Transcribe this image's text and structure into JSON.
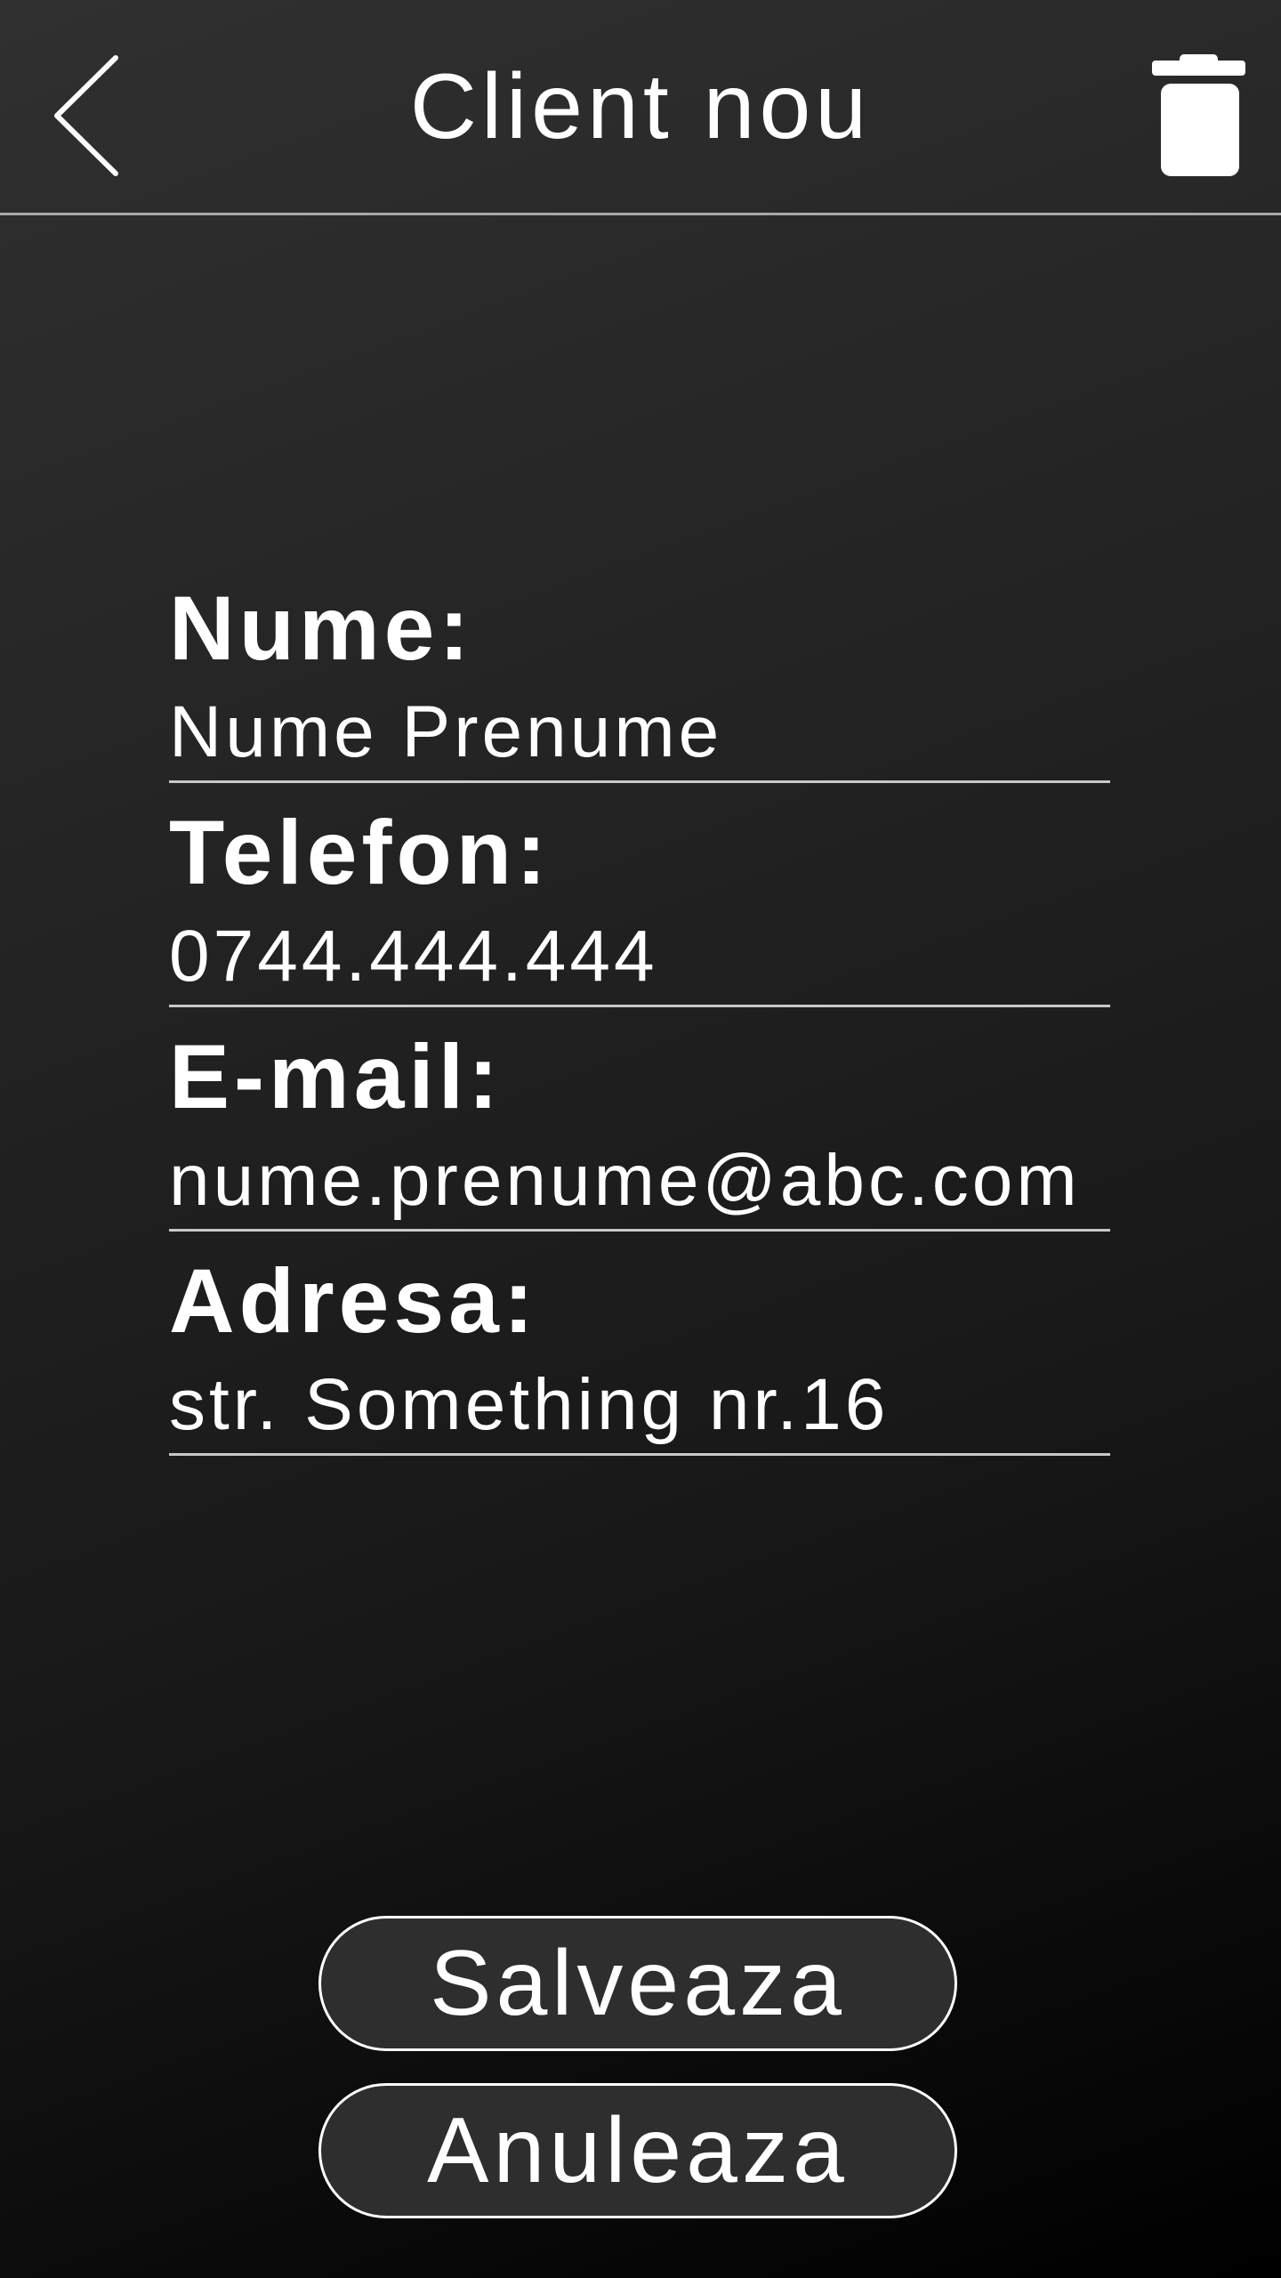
{
  "header": {
    "title": "Client nou",
    "back_icon": "chevron-left-icon",
    "delete_icon": "trash-icon"
  },
  "form": {
    "fields": [
      {
        "label": "Nume:",
        "value": "Nume Prenume"
      },
      {
        "label": "Telefon:",
        "value": "0744.444.444"
      },
      {
        "label": "E-mail:",
        "value": "nume.prenume@abc.com"
      },
      {
        "label": "Adresa:",
        "value": "str. Something nr.16"
      }
    ]
  },
  "buttons": {
    "save_label": "Salveaza",
    "cancel_label": "Anuleaza"
  },
  "colors": {
    "background_top": "#303030",
    "background_bottom": "#000000",
    "text": "#ffffff",
    "button_fill": "#2e2e2e",
    "divider": "#a9a9a9"
  }
}
